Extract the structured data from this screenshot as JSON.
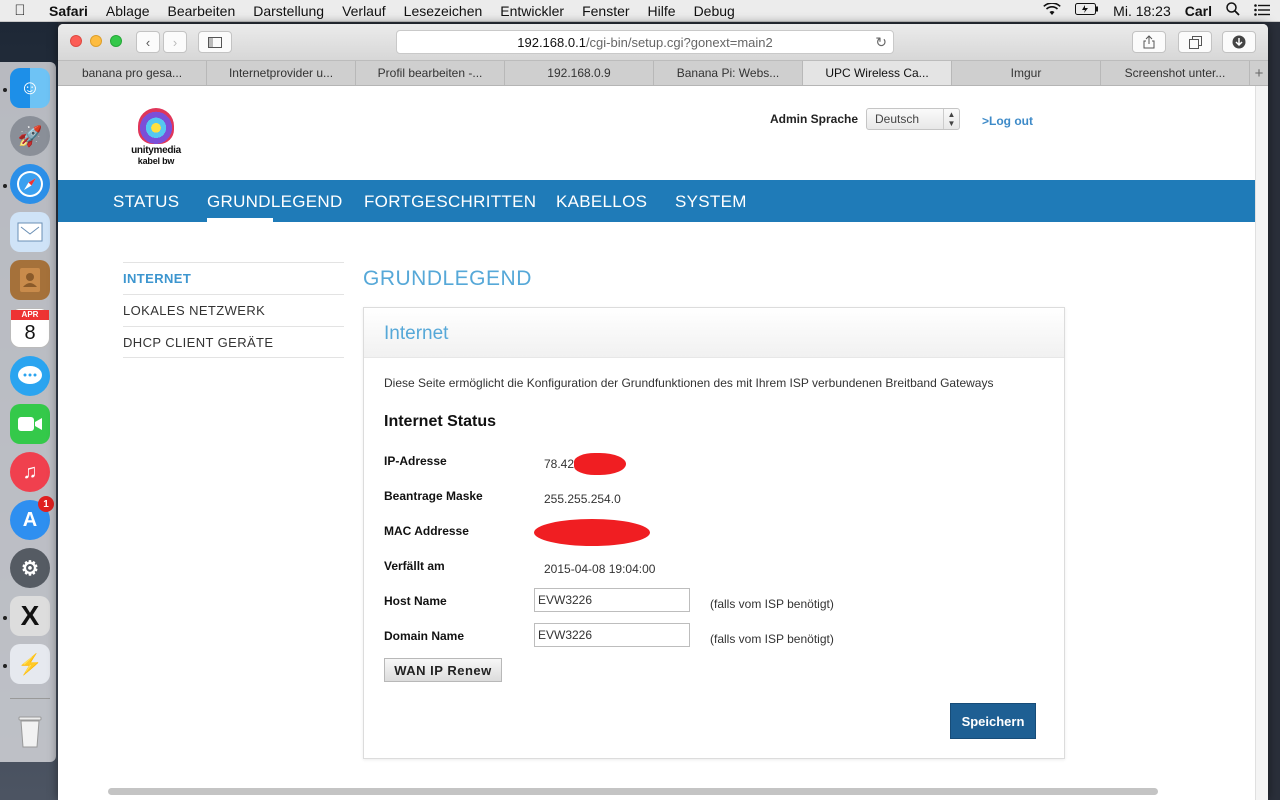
{
  "menubar": {
    "app": "Safari",
    "items": [
      "Ablage",
      "Bearbeiten",
      "Darstellung",
      "Verlauf",
      "Lesezeichen",
      "Entwickler",
      "Fenster",
      "Hilfe",
      "Debug"
    ],
    "clock": "Mi. 18:23",
    "user": "Carl"
  },
  "browser": {
    "url_host": "192.168.0.1",
    "url_path": "/cgi-bin/setup.cgi?gonext=main2",
    "tabs": [
      {
        "label": "banana pro gesa..."
      },
      {
        "label": "Internetprovider u..."
      },
      {
        "label": "Profil bearbeiten -..."
      },
      {
        "label": "192.168.0.9"
      },
      {
        "label": "Banana Pi: Webs..."
      },
      {
        "label": "UPC Wireless Ca..."
      },
      {
        "label": "Imgur"
      },
      {
        "label": "Screenshot unter..."
      }
    ],
    "add_tab": "+"
  },
  "dock": {
    "calendar_month": "APR",
    "calendar_day": "8",
    "appstore_badge": "1"
  },
  "header": {
    "logo_line1": "unitymedia",
    "logo_line2": "kabel bw",
    "lang_label": "Admin Sprache",
    "lang_value": "Deutsch",
    "logout": ">Log out"
  },
  "mainnav": [
    "STATUS",
    "GRUNDLEGEND",
    "FORTGESCHRITTEN",
    "KABELLOS",
    "SYSTEM"
  ],
  "sidenav": [
    "INTERNET",
    "LOKALES NETZWERK",
    "DHCP CLIENT GERÄTE"
  ],
  "content": {
    "page_title": "GRUNDLEGEND",
    "panel_title": "Internet",
    "description": "Diese Seite ermöglicht die Konfiguration der Grundfunktionen des mit Ihrem ISP verbundenen Breitband Gateways",
    "status_heading": "Internet Status",
    "rows": {
      "ip_label": "IP-Adresse",
      "ip_value": "78.42",
      "mask_label": "Beantrage Maske",
      "mask_value": "255.255.254.0",
      "mac_label": "MAC Addresse",
      "mac_value": "",
      "expires_label": "Verfällt am",
      "expires_value": "2015-04-08 19:04:00",
      "host_label": "Host Name",
      "host_value": "EVW3226",
      "domain_label": "Domain Name",
      "domain_value": "EVW3226",
      "hint": "(falls vom ISP benötigt)"
    },
    "renew_button": "WAN IP Renew",
    "save_button": "Speichern"
  },
  "colors": {
    "nav_blue": "#1f7bb8",
    "heading_blue": "#56a8d8",
    "save_blue": "#1e5f93",
    "redaction": "#f01e22"
  }
}
